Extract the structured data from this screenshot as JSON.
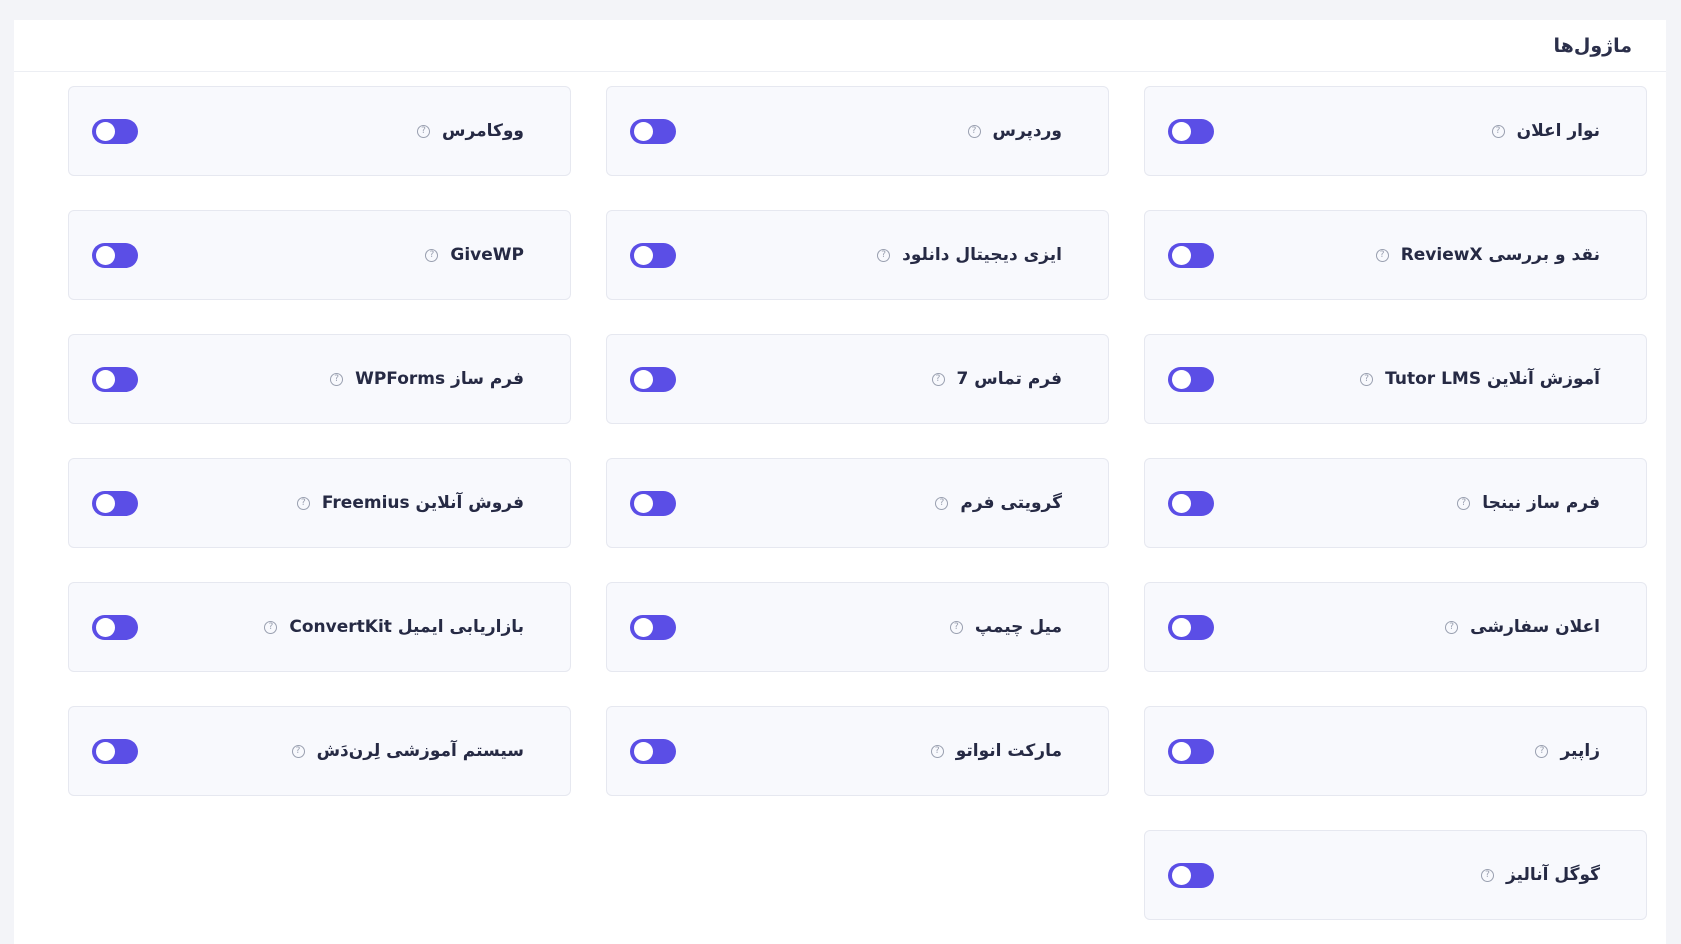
{
  "header": {
    "title": "ماژول‌ها"
  },
  "modules": [
    {
      "label": "نوار اعلان",
      "enabled": true,
      "help_icon": "question-circle-icon"
    },
    {
      "label": "وردپرس",
      "enabled": true,
      "help_icon": "question-circle-icon"
    },
    {
      "label": "ووکامرس",
      "enabled": true,
      "help_icon": "question-circle-icon"
    },
    {
      "label": "نقد و بررسی ReviewX",
      "enabled": true,
      "help_icon": "question-circle-icon"
    },
    {
      "label": "ایزی دیجیتال دانلود",
      "enabled": true,
      "help_icon": "question-circle-icon"
    },
    {
      "label": "GiveWP",
      "enabled": true,
      "help_icon": "question-circle-icon"
    },
    {
      "label": "آموزش آنلاین Tutor LMS",
      "enabled": true,
      "help_icon": "question-circle-icon"
    },
    {
      "label": "فرم تماس 7",
      "enabled": true,
      "help_icon": "question-circle-icon"
    },
    {
      "label": "فرم ساز WPForms",
      "enabled": true,
      "help_icon": "question-circle-icon"
    },
    {
      "label": "فرم ساز نینجا",
      "enabled": true,
      "help_icon": "question-circle-icon"
    },
    {
      "label": "گرویتی فرم",
      "enabled": true,
      "help_icon": "question-circle-icon"
    },
    {
      "label": "فروش آنلاین Freemius",
      "enabled": true,
      "help_icon": "question-circle-icon"
    },
    {
      "label": "اعلان سفارشی",
      "enabled": true,
      "help_icon": "question-circle-icon"
    },
    {
      "label": "میل چیمپ",
      "enabled": true,
      "help_icon": "question-circle-icon"
    },
    {
      "label": "بازاریابی ایمیل ConvertKit",
      "enabled": true,
      "help_icon": "question-circle-icon"
    },
    {
      "label": "زاپیر",
      "enabled": true,
      "help_icon": "question-circle-icon"
    },
    {
      "label": "مارکت انواتو",
      "enabled": true,
      "help_icon": "question-circle-icon"
    },
    {
      "label": "سیستم آموزشی لِرن‌دَش",
      "enabled": true,
      "help_icon": "question-circle-icon"
    },
    {
      "label": "گوگل آنالیز",
      "enabled": true,
      "help_icon": "question-circle-icon"
    }
  ],
  "colors": {
    "toggle_on": "#5b4ee6",
    "card_bg": "#f8f9fd",
    "card_border": "#e6e8f0",
    "text": "#262a44"
  }
}
